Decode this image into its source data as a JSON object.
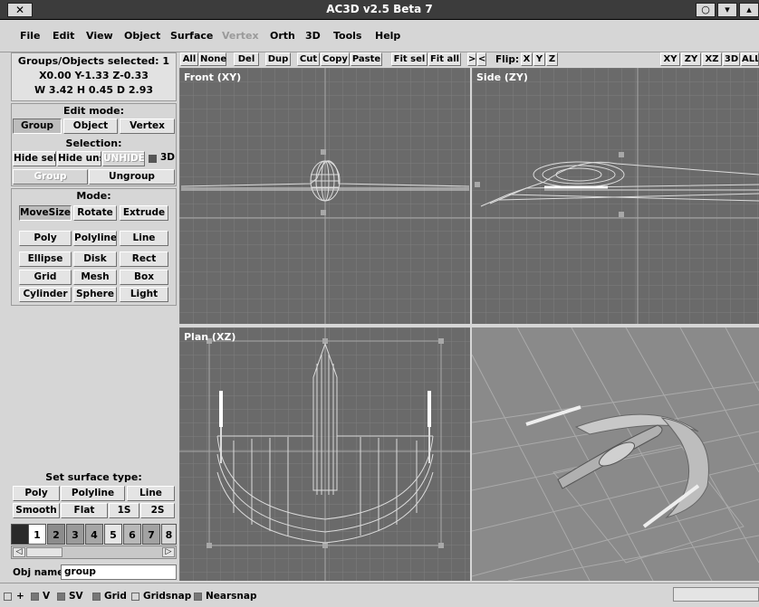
{
  "window": {
    "title": "AC3D v2.5 Beta 7",
    "close_glyph": "✕",
    "buttons": [
      "○",
      "▾",
      "▴"
    ]
  },
  "menu": [
    "File",
    "Edit",
    "View",
    "Object",
    "Surface",
    "Vertex",
    "Orth",
    "3D",
    "Tools",
    "Help"
  ],
  "menu_disabled": [
    "Vertex"
  ],
  "info": {
    "line1": "Groups/Objects selected: 1",
    "line2": "X0.00 Y-1.33 Z-0.33",
    "line3": "W 3.42 H 0.45 D 2.93"
  },
  "edit_mode": {
    "heading": "Edit mode:",
    "buttons": [
      "Group",
      "Object",
      "Vertex"
    ],
    "active": "Group"
  },
  "selection": {
    "heading": "Selection:",
    "hide_sel": "Hide sel",
    "hide_uns": "Hide uns",
    "unhide": "UNHIDE",
    "toggle_3d": "3D",
    "group": "Group",
    "ungroup": "Ungroup"
  },
  "mode": {
    "heading": "Mode:",
    "row1": [
      "MoveSize",
      "Rotate",
      "Extrude"
    ],
    "active": "MoveSize",
    "row2": [
      "Poly",
      "Polyline",
      "Line"
    ],
    "row3": [
      "Ellipse",
      "Disk",
      "Rect"
    ],
    "row4": [
      "Grid",
      "Mesh",
      "Box"
    ],
    "row5": [
      "Cylinder",
      "Sphere",
      "Light"
    ]
  },
  "surface": {
    "heading": "Set surface type:",
    "row1": [
      "Poly",
      "Polyline",
      "Line"
    ],
    "row2": [
      "Smooth",
      "Flat",
      "1S",
      "2S"
    ]
  },
  "palette": {
    "labels": [
      "",
      "1",
      "2",
      "3",
      "4",
      "5",
      "6",
      "7",
      "8"
    ],
    "colors": [
      "#2a2a2a",
      "#ffffff",
      "#8c8c8c",
      "#9a9a9a",
      "#a6a6a6",
      "#e6e6e6",
      "#b8b8b8",
      "#a2a2a2",
      "#d8d8d8"
    ]
  },
  "obj_name": {
    "label": "Obj name:",
    "value": "group"
  },
  "toolbar": {
    "buttons": [
      "All",
      "None",
      "Del",
      "Dup",
      "Cut",
      "Copy",
      "Paste",
      "Fit sel",
      "Fit all",
      ">",
      "<"
    ],
    "flip_label": "Flip:",
    "flip": [
      "X",
      "Y",
      "Z"
    ],
    "views": [
      "XY",
      "ZY",
      "XZ",
      "3D",
      "ALL"
    ]
  },
  "viewports": {
    "front": "Front (XY)",
    "side": "Side (ZY)",
    "plan": "Plan (XZ)"
  },
  "statusbar": {
    "plus": "+",
    "items": [
      "V",
      "SV",
      "Grid",
      "Gridsnap",
      "Nearsnap"
    ]
  },
  "colors": {
    "viewport_bg": "#6a6a6a",
    "grid": "#7e7e7e",
    "axis": "#9c9c9c",
    "wire": "#dcdcdc",
    "perspective_bg": "#8a8a8a"
  }
}
